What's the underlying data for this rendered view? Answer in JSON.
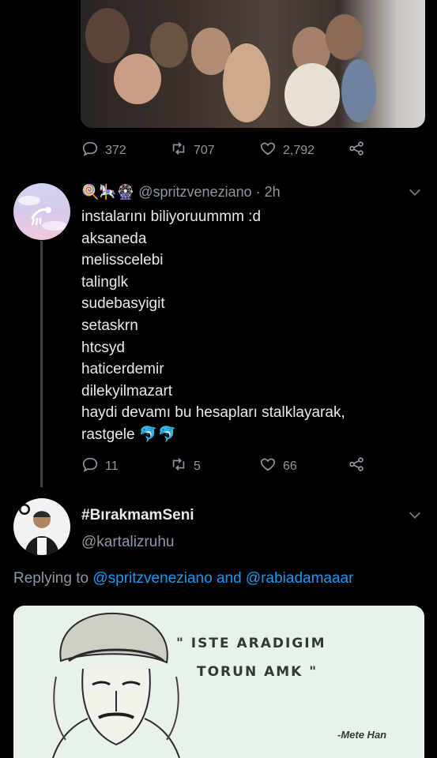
{
  "tweet1": {
    "stats": {
      "replies": "372",
      "retweets": "707",
      "likes": "2,792"
    }
  },
  "tweet2": {
    "emoji": "🍭🎠🎡",
    "handle": "@spritzveneziano",
    "time": "· 2h",
    "lines": [
      "instalarını biliyoruummm :d",
      "aksaneda",
      "melisscelebi",
      "talinglk",
      "sudebasyigit",
      "setaskrn",
      "htcsyd",
      "haticerdemir",
      "dilekyilmazart",
      "haydi devamı bu hesapları stalklayarak,",
      "rastgele 🐬🐬"
    ],
    "stats": {
      "replies": "11",
      "retweets": "5",
      "likes": "66"
    }
  },
  "tweet3": {
    "name": "#BırakmamSeni",
    "handle": "@kartalizruhu",
    "reply_prefix": "Replying to",
    "reply_user1": "@spritzveneziano",
    "reply_and": "and",
    "reply_user2": "@rabiadamaaar",
    "meme": {
      "quote_line1": "\" ISTE ARADIGIM",
      "quote_line2": "TORUN AMK \"",
      "signature": "-Mete Han"
    }
  },
  "icons": {
    "reply": "reply-icon",
    "retweet": "retweet-icon",
    "like": "heart-icon",
    "share": "share-icon",
    "chevron": "chevron-down-icon"
  },
  "colors": {
    "background": "#000000",
    "text": "#e7e9ea",
    "muted": "#8b98a5",
    "link": "#1d9bf0"
  }
}
